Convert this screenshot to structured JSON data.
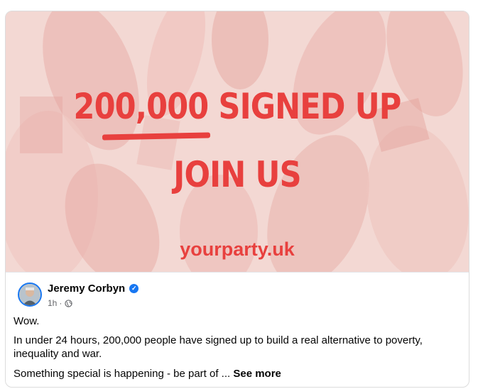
{
  "post": {
    "image": {
      "headline": "200,000 SIGNED UP",
      "subheadline": "JOIN US",
      "url": "yourparty.uk"
    },
    "author": "Jeremy Corbyn",
    "time": "1h",
    "separator": "·",
    "verified_icon": "verified-badge-icon",
    "audience_icon": "globe-icon",
    "paragraphs": [
      "Wow.",
      "In under 24 hours, 200,000 people have signed up to build a real alternative to poverty, inequality and war."
    ],
    "truncated_text": "Something special is happening - be part of ...",
    "see_more": "See more"
  },
  "colors": {
    "accent": "#e8403e",
    "verified": "#1877f2",
    "image_tint": "#f4d6d2"
  }
}
